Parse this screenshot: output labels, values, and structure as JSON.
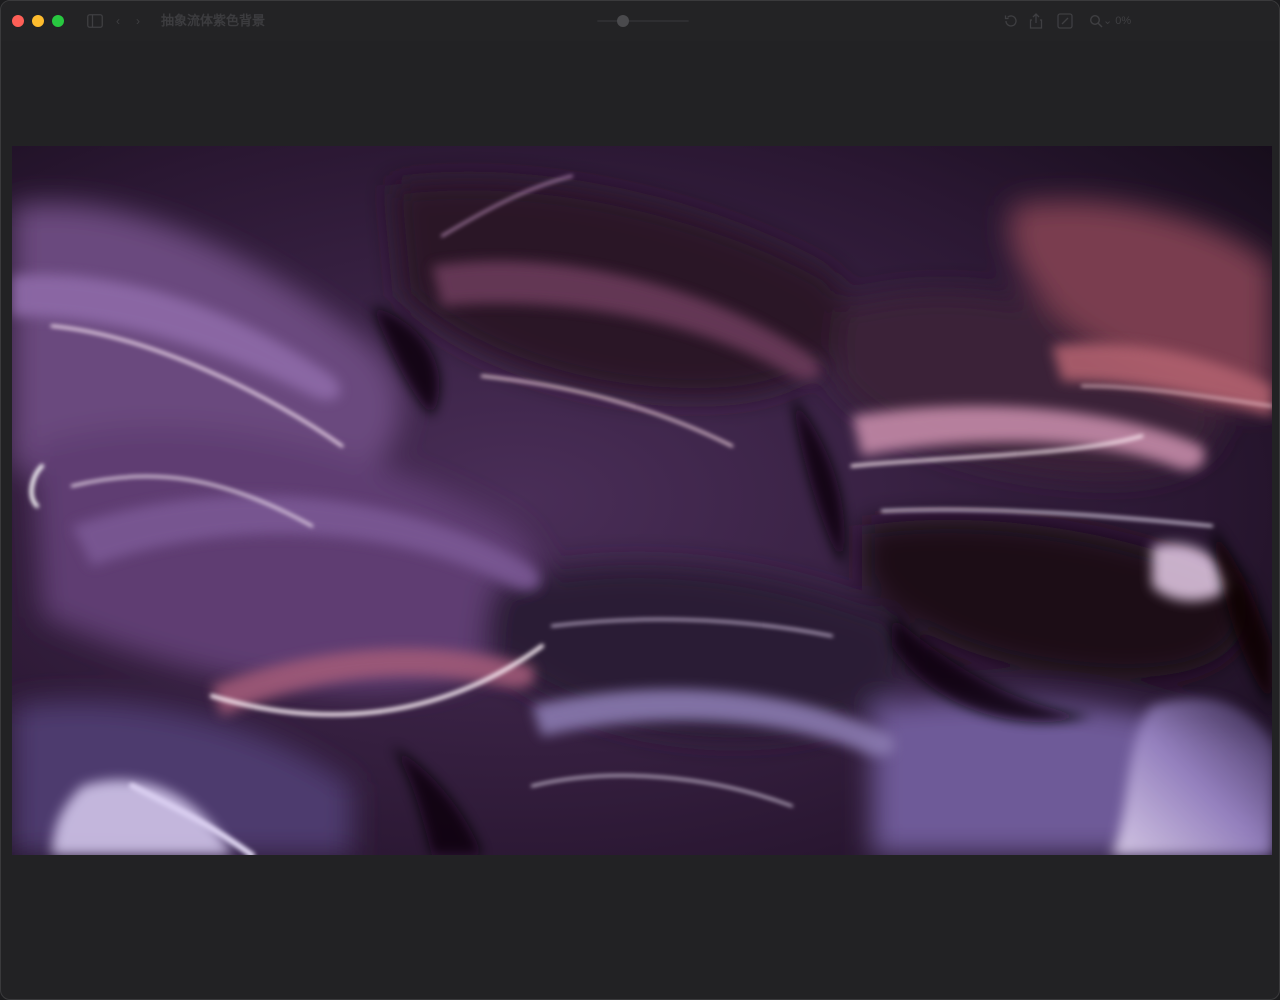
{
  "window": {
    "title": "抽象流体紫色背景",
    "nav_back": "‹",
    "nav_forward": "›",
    "zoom_readout": "⌄ 0%",
    "zoom_level": 0.25
  },
  "toolbar": {
    "icons": [
      "sidebar-toggle-icon",
      "rotate-icon",
      "share-icon",
      "markup-icon",
      "search-icon"
    ]
  },
  "image": {
    "description_colors": {
      "dark": "#0d0810",
      "purple": "#6b4a7e",
      "lilac": "#b29ad0",
      "rose": "#a8566c",
      "highlight": "#f2e8f6"
    }
  }
}
